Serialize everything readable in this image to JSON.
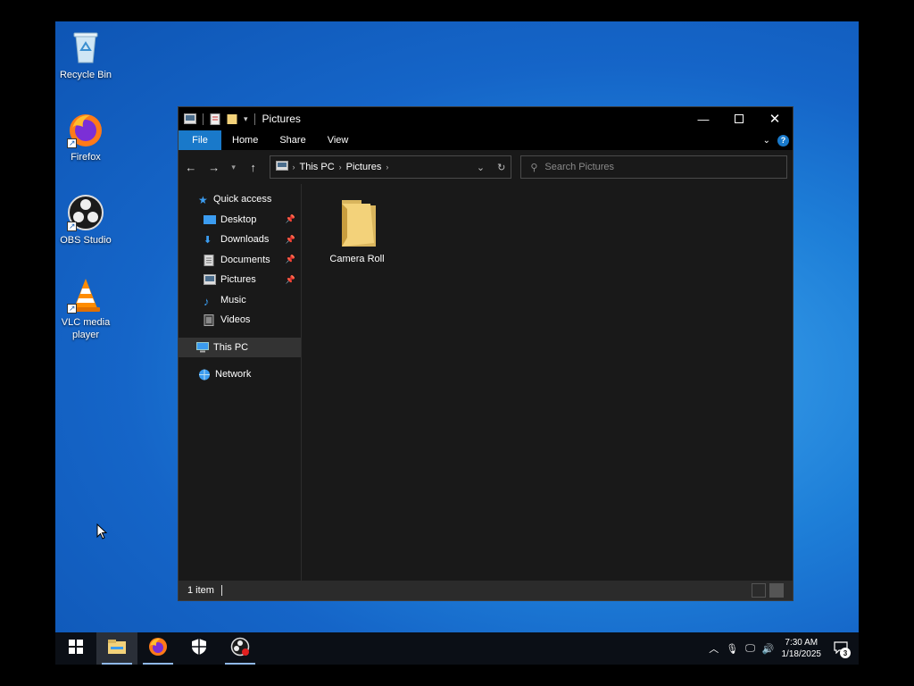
{
  "desktop": {
    "icons": [
      {
        "label": "Recycle Bin"
      },
      {
        "label": "Firefox"
      },
      {
        "label": "OBS Studio"
      },
      {
        "label": "VLC media player"
      }
    ]
  },
  "window": {
    "title": "Pictures",
    "ribbon_tabs": {
      "file": "File",
      "home": "Home",
      "share": "Share",
      "view": "View"
    },
    "address": {
      "segments": [
        "This PC",
        "Pictures"
      ]
    },
    "search": {
      "placeholder": "Search Pictures"
    },
    "nav": {
      "quick_access": "Quick access",
      "desktop": "Desktop",
      "downloads": "Downloads",
      "documents": "Documents",
      "pictures": "Pictures",
      "music": "Music",
      "videos": "Videos",
      "this_pc": "This PC",
      "network": "Network"
    },
    "items": [
      {
        "name": "Camera Roll"
      }
    ],
    "status": {
      "count": "1 item"
    }
  },
  "taskbar": {
    "time": "7:30 AM",
    "date": "1/18/2025",
    "notification_count": "3"
  },
  "colors": {
    "accent": "#1979ca",
    "window_bg": "#191919",
    "folder": "#f3d27a"
  }
}
